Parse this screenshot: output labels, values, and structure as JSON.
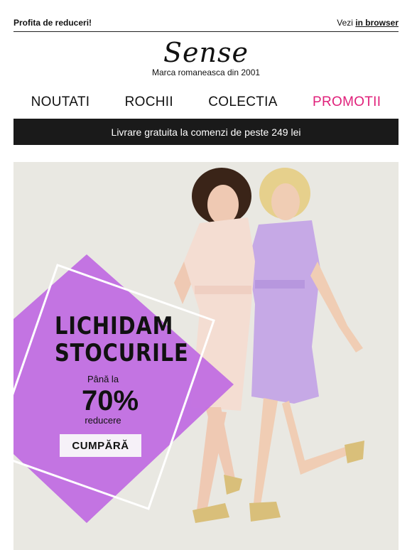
{
  "topbar": {
    "left_text": "Profita de reduceri!",
    "right_prefix": "Vezi",
    "right_link": "in browser"
  },
  "brand": {
    "logo": "Sense",
    "tagline": "Marca romaneasca din 2001"
  },
  "nav": {
    "items": [
      "NOUTATI",
      "ROCHII",
      "COLECTIA",
      "PROMOTII"
    ]
  },
  "shipping_banner": "Livrare gratuita la comenzi de peste 249 lei",
  "hero": {
    "title_line1": "LICHIDAM",
    "title_line2": "STOCURILE",
    "subtitle": "Până la",
    "percent": "70%",
    "discount_label": "reducere",
    "cta": "CUMPĂRĂ"
  },
  "colors": {
    "promo_nav": "#e0207a",
    "banner_bg": "#1a1a1a",
    "diamond": "#c16ee2"
  }
}
